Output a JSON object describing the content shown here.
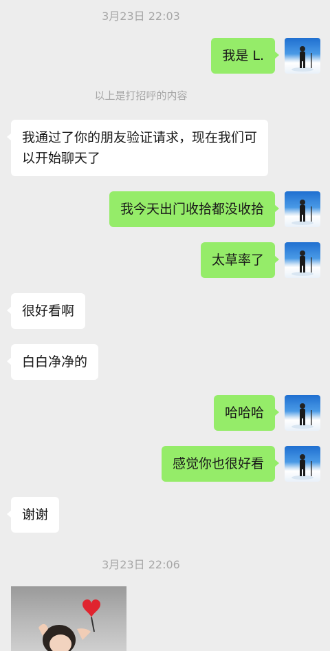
{
  "timestamps": [
    "3月23日 22:03",
    "3月23日 22:06"
  ],
  "system_notice": "以上是打招呼的内容",
  "messages": [
    {
      "side": "right",
      "text": "我是 L."
    },
    {
      "side": "left",
      "text": "我通过了你的朋友验证请求，现在我们可以开始聊天了"
    },
    {
      "side": "right",
      "text": "我今天出门收拾都没收拾"
    },
    {
      "side": "right",
      "text": "太草率了"
    },
    {
      "side": "left",
      "text": "很好看啊"
    },
    {
      "side": "left",
      "text": "白白净净的"
    },
    {
      "side": "right",
      "text": "哈哈哈"
    },
    {
      "side": "right",
      "text": "感觉你也很好看"
    },
    {
      "side": "left",
      "text": "谢谢"
    }
  ],
  "colors": {
    "background": "#ededed",
    "bubble_self": "#95ec69",
    "bubble_other": "#ffffff",
    "timestamp_text": "#a6a6a6"
  },
  "images": {
    "avatar": "avatar-person-in-snow",
    "sticker": "sticker-child-with-heart"
  }
}
